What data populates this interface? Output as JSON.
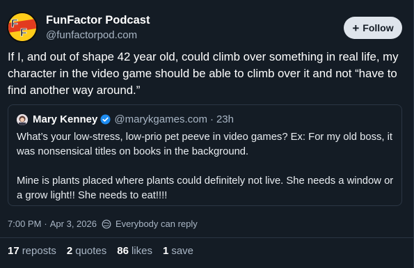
{
  "author": {
    "name": "FunFactor Podcast",
    "handle": "@funfactorpod.com",
    "avatar_initials": "FF"
  },
  "follow_button": {
    "icon": "plus-icon",
    "label": "Follow"
  },
  "post": {
    "text": "If I, and out of shape 42 year old, could climb over something in real life, my character in the video game should be able to climb over it and not “have to find another way around.”"
  },
  "quote": {
    "author_name": "Mary Kenney",
    "verified": true,
    "handle": "@marykgames.com",
    "separator": "·",
    "time": "23h",
    "paragraphs": [
      "What’s your low-stress, low-prio pet peeve in video games? Ex: For my old boss, it was nonsensical titles on books in the background.",
      "Mine is plants placed where plants could definitely not live. She needs a window or a grow light!! She needs to eat!!!!"
    ]
  },
  "meta": {
    "time": "7:00 PM",
    "separator": "·",
    "date": "Apr 3, 2026",
    "reply_setting": "Everybody can reply"
  },
  "stats": {
    "reposts": {
      "count": "17",
      "label": "reposts"
    },
    "quotes": {
      "count": "2",
      "label": "quotes"
    },
    "likes": {
      "count": "86",
      "label": "likes"
    },
    "saves": {
      "count": "1",
      "label": "save"
    }
  },
  "colors": {
    "background": "#141c25",
    "text_primary": "#ffffff",
    "text_secondary": "#a9b6c5",
    "border": "#2b3644",
    "verified": "#1d8cf0",
    "follow_bg": "#dfe5ec"
  }
}
